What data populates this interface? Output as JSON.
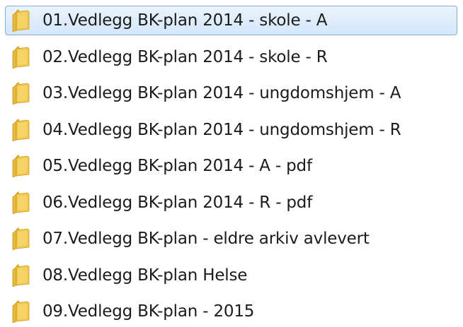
{
  "folders": [
    {
      "name": "01.Vedlegg BK-plan 2014 - skole - A",
      "selected": true,
      "icon": "folder-icon"
    },
    {
      "name": "02.Vedlegg BK-plan 2014 - skole - R",
      "selected": false,
      "icon": "folder-icon"
    },
    {
      "name": "03.Vedlegg BK-plan 2014 - ungdomshjem - A",
      "selected": false,
      "icon": "folder-icon"
    },
    {
      "name": "04.Vedlegg BK-plan 2014 - ungdomshjem - R",
      "selected": false,
      "icon": "folder-icon"
    },
    {
      "name": "05.Vedlegg BK-plan 2014 - A - pdf",
      "selected": false,
      "icon": "folder-icon"
    },
    {
      "name": "06.Vedlegg BK-plan 2014 - R - pdf",
      "selected": false,
      "icon": "folder-icon"
    },
    {
      "name": "07.Vedlegg BK-plan - eldre arkiv avlevert",
      "selected": false,
      "icon": "folder-icon"
    },
    {
      "name": "08.Vedlegg BK-plan Helse",
      "selected": false,
      "icon": "folder-icon"
    },
    {
      "name": "09.Vedlegg BK-plan - 2015",
      "selected": false,
      "icon": "folder-icon"
    }
  ],
  "colors": {
    "folder_body": "#f2c84b",
    "folder_back": "#dcae2f",
    "selection_fill": "#d3e7fb",
    "selection_border": "#84acdd"
  }
}
